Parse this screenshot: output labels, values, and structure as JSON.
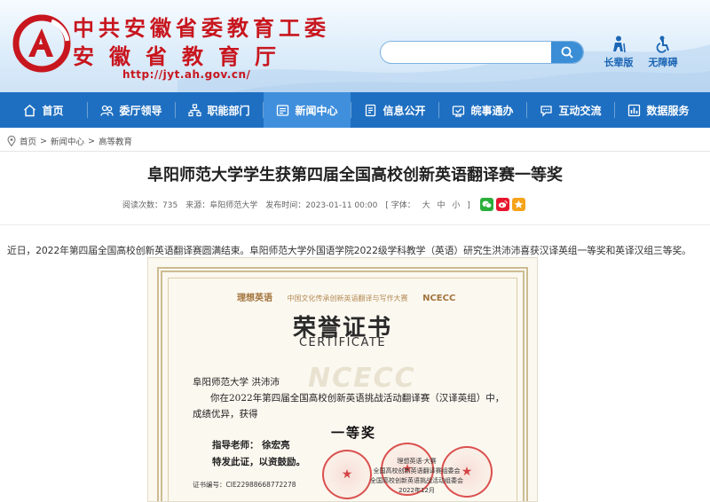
{
  "header": {
    "title_line1": "中共安徽省委教育工委",
    "title_line2": "安徽省教育厅",
    "url": "http://jyt.ah.gov.cn/",
    "search_placeholder": "",
    "tools": [
      {
        "label": "长辈版",
        "icon": "elder-icon"
      },
      {
        "label": "无障碍",
        "icon": "accessibility-icon"
      }
    ]
  },
  "nav": {
    "items": [
      {
        "label": "首页",
        "icon": "home-icon"
      },
      {
        "label": "委厅领导",
        "icon": "leaders-icon"
      },
      {
        "label": "职能部门",
        "icon": "departments-icon"
      },
      {
        "label": "新闻中心",
        "icon": "news-icon",
        "active": true
      },
      {
        "label": "信息公开",
        "icon": "info-icon"
      },
      {
        "label": "皖事通办",
        "icon": "service-icon"
      },
      {
        "label": "互动交流",
        "icon": "chat-icon"
      },
      {
        "label": "数据服务",
        "icon": "data-icon"
      }
    ]
  },
  "breadcrumb": {
    "items": [
      "首页",
      "新闻中心",
      "高等教育"
    ],
    "separator": ">"
  },
  "article": {
    "title": "阜阳师范大学学生获第四届全国高校创新英语翻译赛一等奖",
    "views_label": "阅读次数：",
    "views": "735",
    "source_label": "来源：",
    "source": "阜阳师范大学",
    "date_label": "发布时间：",
    "date": "2023-01-11 00:00",
    "font_label": "[ 字体：",
    "font_sizes": [
      "大",
      "中",
      "小"
    ],
    "font_close": "]",
    "paragraph": "近日，2022年第四届全国高校创新英语翻译赛圆满结束。阜阳师范大学外国语学院2022级学科教学（英语）研究生洪沛沛喜获汉译英组一等奖和英译汉组三等奖。"
  },
  "certificate": {
    "logo_left": "理想英语",
    "logo_mid": "中国文化传承创新英语翻译与写作大赛",
    "logo_right": "NCECC",
    "title": "荣誉证书",
    "subtitle": "CERTIFICATE",
    "recipient": "阜阳师范大学 洪沛沛",
    "line1": "你在2022年第四届全国高校创新英语挑战活动翻译赛（汉译英组）中，",
    "line2": "成绩优异，获得",
    "prize": "一等奖",
    "advisor": "指导老师：   徐宏亮",
    "award_note": "特发此证，以资鼓励。",
    "cert_id": "证书编号：CIE22988668772278",
    "watermark": "NCECC",
    "org_lines": [
      "理想英语·大赛",
      "全国高校创新英语翻译赛组委会",
      "全国高校创新英语挑战活动组委会",
      "2022年12月"
    ]
  },
  "colors": {
    "brand_red": "#c8161e",
    "nav_blue": "#1e6fc1",
    "nav_active": "#3f8fdd"
  }
}
